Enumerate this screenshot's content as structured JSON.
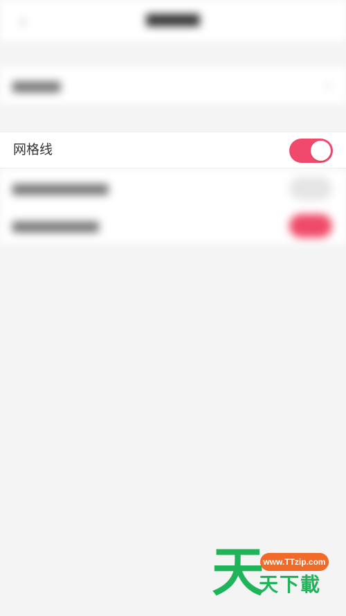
{
  "settings": {
    "grid_row": {
      "label": "网格线",
      "toggle_on": true
    }
  },
  "colors": {
    "accent": "#f1496b",
    "background": "#f4f4f4",
    "watermark_green": "#1fb45a",
    "watermark_orange": "#f06a2a"
  },
  "icons": {
    "back": "back-arrow-icon",
    "chevron": "chevron-right-icon"
  },
  "watermark": {
    "url": "www.TTzip.com",
    "big_char": "天",
    "text": "天下載"
  }
}
